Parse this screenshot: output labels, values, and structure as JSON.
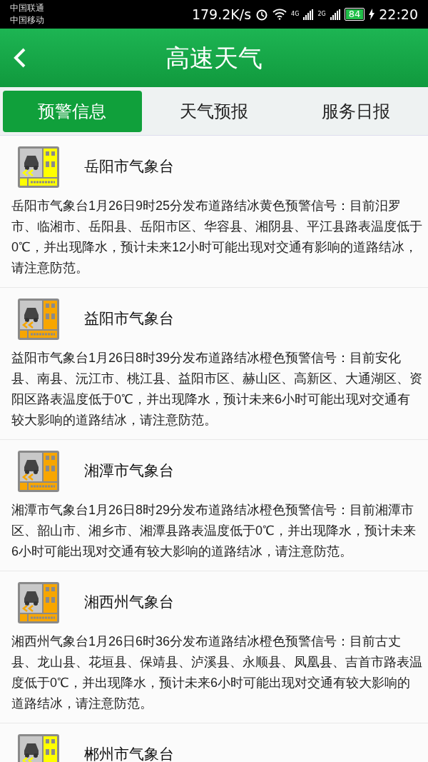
{
  "status_bar": {
    "carriers": [
      "中国联通",
      "中国移动"
    ],
    "speed": "179.2K/s",
    "network_1": "4G",
    "network_2": "2G",
    "battery": "84",
    "time": "22:20"
  },
  "header": {
    "title": "高速天气"
  },
  "tabs": [
    {
      "label": "预警信息",
      "selected": true
    },
    {
      "label": "天气预报",
      "selected": false
    },
    {
      "label": "服务日报",
      "selected": false
    }
  ],
  "warnings": [
    {
      "station": "岳阳市气象台",
      "color": "#ffff00",
      "text": "岳阳市气象台1月26日9时25分发布道路结冰黄色预警信号：目前汨罗市、临湘市、岳阳县、岳阳市区、华容县、湘阴县、平江县路表温度低于0℃，并出现降水，预计未来12小时可能出现对交通有影响的道路结冰，请注意防范。"
    },
    {
      "station": "益阳市气象台",
      "color": "#f7a600",
      "text": "益阳市气象台1月26日8时39分发布道路结冰橙色预警信号：目前安化县、南县、沅江市、桃江县、益阳市区、赫山区、高新区、大通湖区、资阳区路表温度低于0℃，并出现降水，预计未来6小时可能出现对交通有较大影响的道路结冰，请注意防范。"
    },
    {
      "station": "湘潭市气象台",
      "color": "#f7a600",
      "text": "湘潭市气象台1月26日8时29分发布道路结冰橙色预警信号：目前湘潭市区、韶山市、湘乡市、湘潭县路表温度低于0℃，并出现降水，预计未来6小时可能出现对交通有较大影响的道路结冰，请注意防范。"
    },
    {
      "station": "湘西州气象台",
      "color": "#f7a600",
      "text": "湘西州气象台1月26日6时36分发布道路结冰橙色预警信号：目前古丈县、龙山县、花垣县、保靖县、泸溪县、永顺县、凤凰县、吉首市路表温度低于0℃，并出现降水，预计未来6小时可能出现对交通有较大影响的道路结冰，请注意防范。"
    },
    {
      "station": "郴州市气象台",
      "color": "#ffff00"
    }
  ]
}
